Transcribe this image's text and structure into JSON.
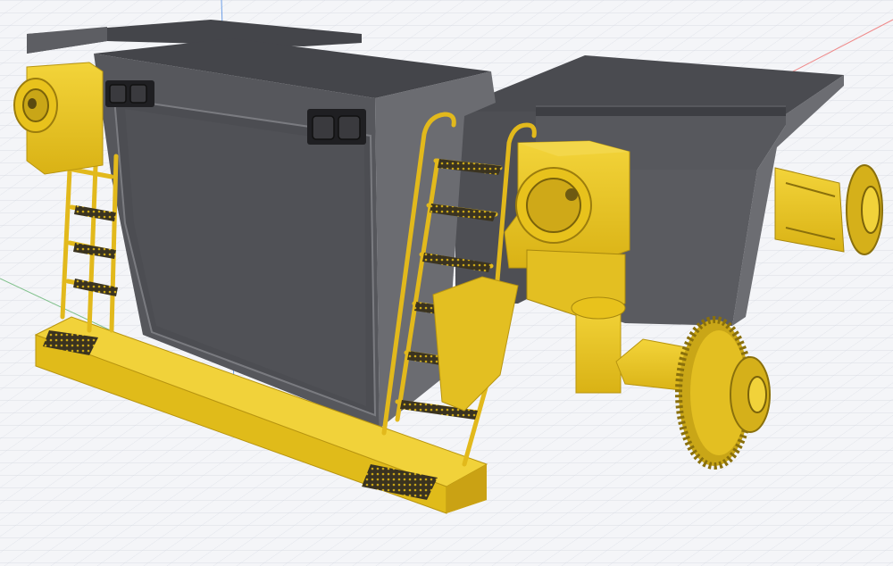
{
  "viewport": {
    "background": "#f4f5f8",
    "grid_color": "#d7dbe3",
    "axis_colors": {
      "x": "#ef8a8a",
      "y": "#7fc08a",
      "z": "#6f9fe6"
    }
  },
  "model": {
    "body_color": "#55565b",
    "body_side_color": "#6c6d72",
    "body_top_color": "#44454a",
    "accent_color": "#e8c21c",
    "accent_shade": "#b89510",
    "grate_color": "#3a3320",
    "icon": "locomotive-3d-model"
  }
}
